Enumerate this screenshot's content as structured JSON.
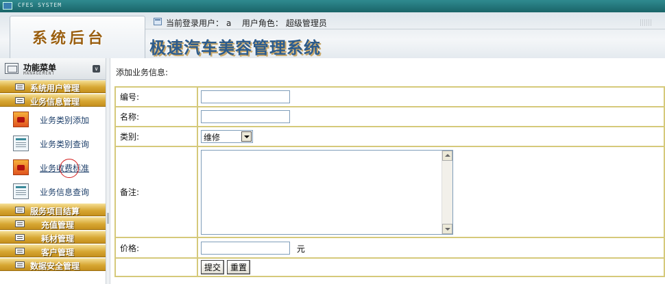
{
  "topbar": {
    "system_label": "CFES SYSTEM"
  },
  "header": {
    "tab_title": "系统后台",
    "user_label": "当前登录用户：",
    "user_value": "a",
    "role_label": "用户角色：",
    "role_value": "超级管理员",
    "app_title": "极速汽车美容管理系统"
  },
  "sidebar": {
    "title": "功能菜单",
    "subtitle": "MANAGEMENT",
    "groups": [
      {
        "label": "系统用户管理",
        "icon": "list-icon"
      },
      {
        "label": "业务信息管理",
        "icon": "list-icon"
      },
      {
        "label": "服务项目结算",
        "icon": "list-icon"
      },
      {
        "label": "充值管理",
        "icon": "list-icon"
      },
      {
        "label": "耗材管理",
        "icon": "list-icon"
      },
      {
        "label": "客户管理",
        "icon": "list-icon"
      },
      {
        "label": "数据安全管理",
        "icon": "list-icon"
      }
    ],
    "items": [
      {
        "label": "业务类别添加",
        "icon": "add-category-icon"
      },
      {
        "label": "业务类别查询",
        "icon": "query-document-icon"
      },
      {
        "label": "业务收费标准",
        "icon": "fee-standard-icon"
      },
      {
        "label": "业务信息查询",
        "icon": "query-document-icon"
      }
    ]
  },
  "form": {
    "title": "添加业务信息:",
    "fields": {
      "number_label": "编号:",
      "number_value": "",
      "name_label": "名称:",
      "name_value": "",
      "category_label": "类别:",
      "category_value": "维修",
      "remark_label": "备注:",
      "remark_value": "",
      "price_label": "价格:",
      "price_value": "",
      "price_unit": "元"
    },
    "submit_label": "提交",
    "reset_label": "重置"
  },
  "colors": {
    "menu_gold": "#d7a733",
    "table_border": "#d5c97a",
    "app_title_blue": "#2d5c8c",
    "tab_title_brown": "#9a5f10",
    "topbar_teal": "#1a6569"
  }
}
